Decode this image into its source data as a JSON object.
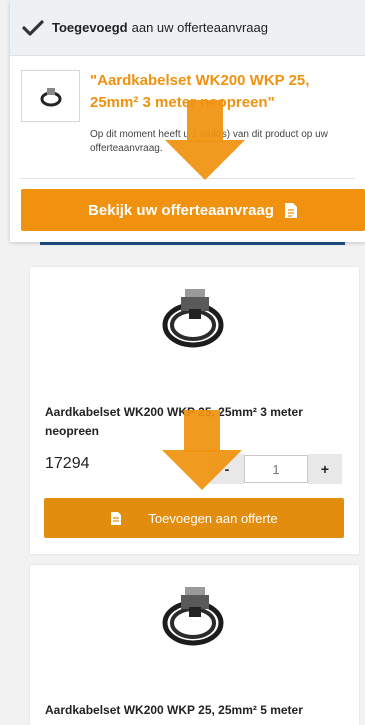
{
  "popup": {
    "added_bold": "Toegevoegd",
    "added_rest": "aan uw offerteaanvraag",
    "product_title": "\"Aardkabelset WK200 WKP 25, 25mm² 3 meter neopreen\"",
    "message": "Op dit moment heeft u 1 stuk(s) van dit product op uw offerteaanvraag.",
    "view_button": "Bekijk uw offerteaanvraag"
  },
  "products": [
    {
      "title": "Aardkabelset WK200 WKP 25, 25mm² 3 meter neopreen",
      "sku": "17294",
      "qty_minus": "-",
      "qty_value": "1",
      "qty_plus": "+",
      "add_button": "Toevoegen aan offerte"
    },
    {
      "title": "Aardkabelset WK200 WKP 25, 25mm² 5 meter"
    }
  ],
  "colors": {
    "accent": "#f0920f",
    "strip": "#1f4f86",
    "header_bg": "#eef1f4"
  },
  "icons": [
    "checkmark-icon",
    "document-icon",
    "cable-clamp-image",
    "down-arrow-overlay"
  ]
}
